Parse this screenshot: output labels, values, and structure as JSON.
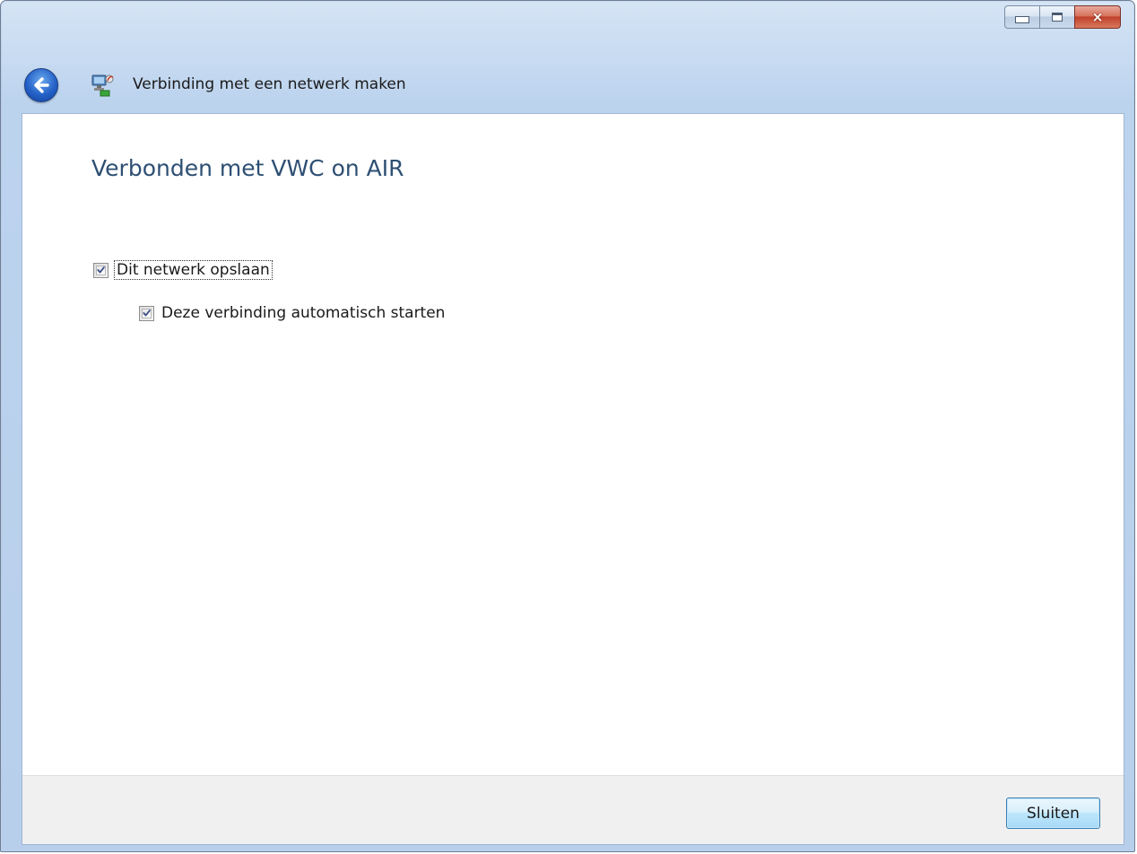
{
  "window": {
    "title": "Verbinding met een netwerk maken",
    "controls": {
      "minimize": "minimize",
      "maximize": "maximize",
      "close": "×"
    }
  },
  "icons": {
    "back": "back-arrow-icon",
    "app": "network-connection-icon"
  },
  "content": {
    "heading": "Verbonden met VWC on AIR",
    "options": [
      {
        "label": "Dit netwerk opslaan",
        "checked": true
      },
      {
        "label": "Deze verbinding automatisch starten",
        "checked": true
      }
    ]
  },
  "footer": {
    "close_label": "Sluiten"
  },
  "colors": {
    "frame": "#b8cfeb",
    "heading": "#2e4f73",
    "footer": "#f0f0f0",
    "button": "#bee6fd"
  }
}
